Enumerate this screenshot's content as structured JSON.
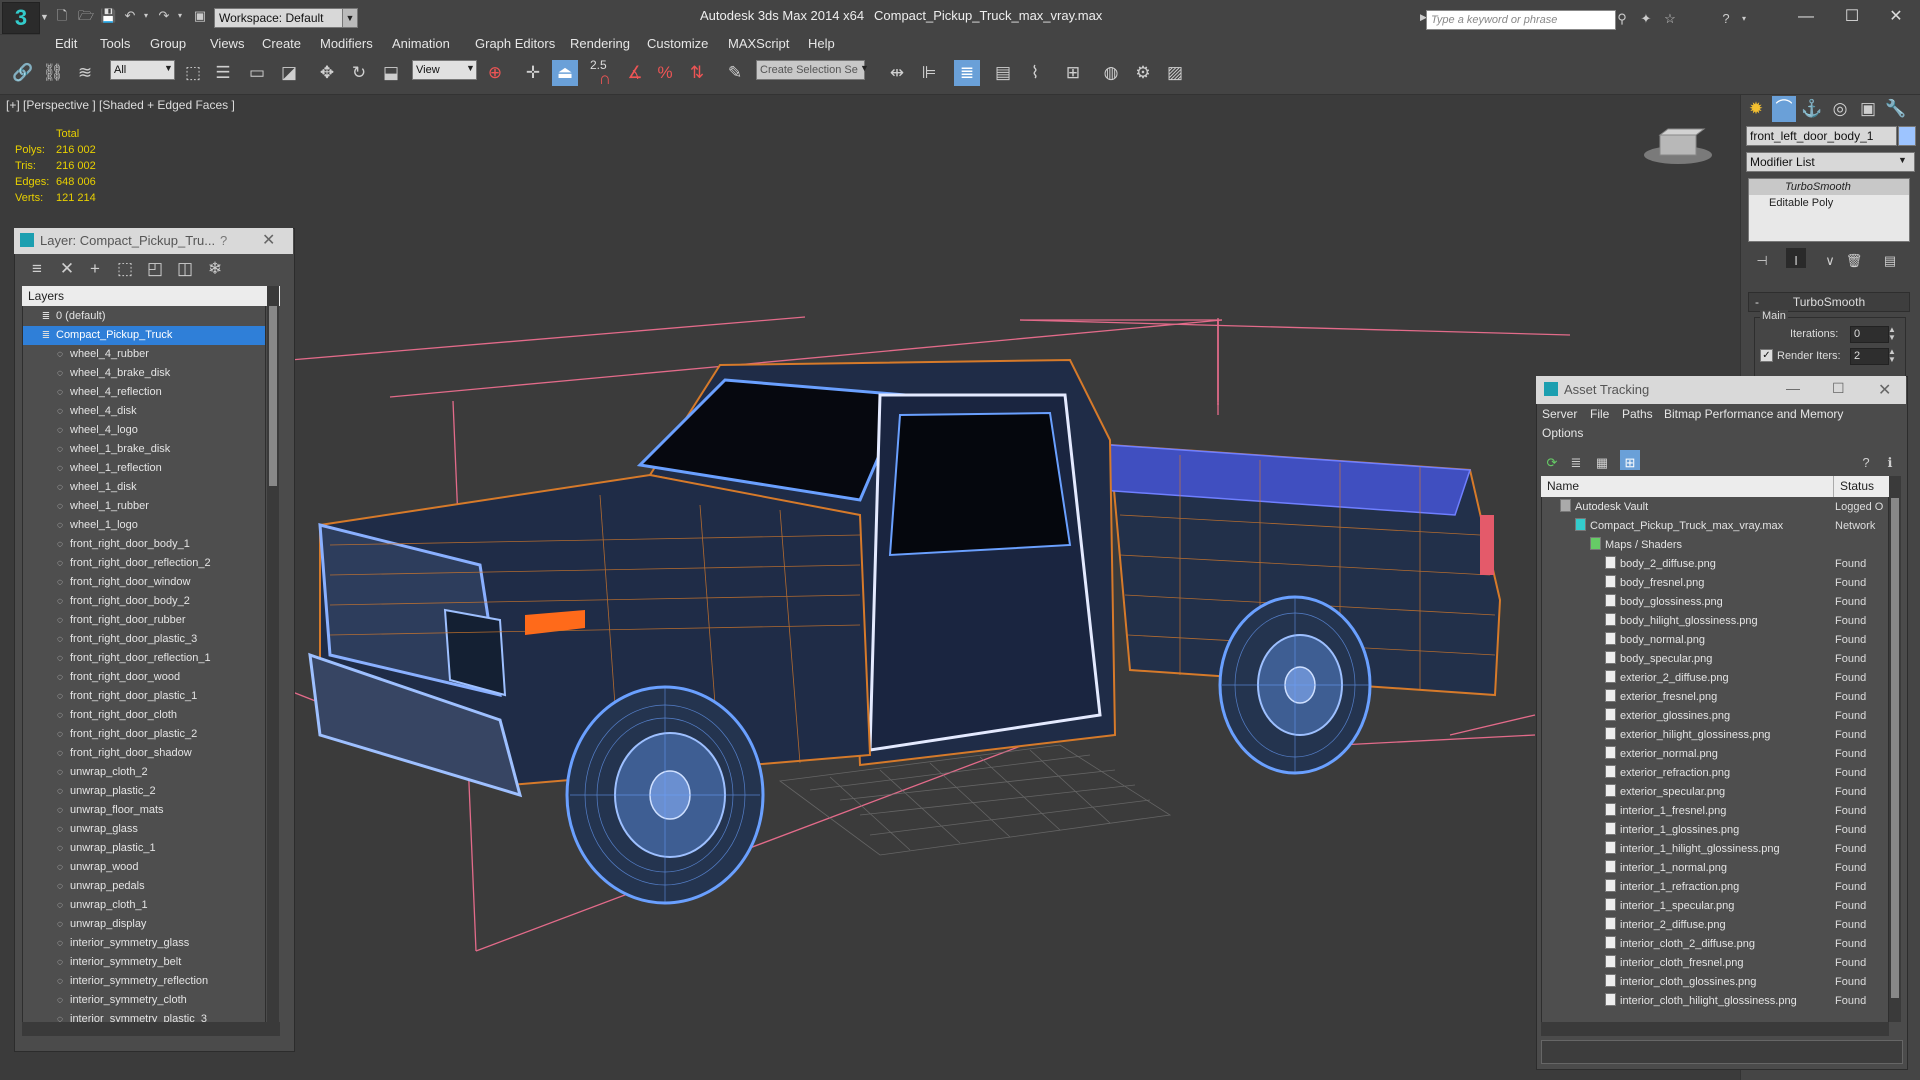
{
  "app": {
    "title": "Autodesk 3ds Max  2014 x64",
    "file": "Compact_Pickup_Truck_max_vray.max",
    "workspace": "Workspace: Default",
    "search_placeholder": "Type a keyword or phrase"
  },
  "menu": [
    "Edit",
    "Tools",
    "Group",
    "Views",
    "Create",
    "Modifiers",
    "Animation",
    "Graph Editors",
    "Rendering",
    "Customize",
    "MAXScript",
    "Help"
  ],
  "toolbar": {
    "selection_filter": "All",
    "ref_coord": "View",
    "snap_value": "2.5",
    "named_selection": "Create Selection Se"
  },
  "viewport": {
    "label": "[+] [Perspective ] [Shaded + Edged Faces ]",
    "stats": {
      "header": "Total",
      "rows": [
        {
          "label": "Polys:",
          "value": "216 002"
        },
        {
          "label": "Tris:",
          "value": "216 002"
        },
        {
          "label": "Edges:",
          "value": "648 006"
        },
        {
          "label": "Verts:",
          "value": "121 214"
        }
      ]
    }
  },
  "layer_window": {
    "title": "Layer: Compact_Pickup_Tru...",
    "help": "?",
    "column": "Layers",
    "rows": [
      {
        "label": "0 (default)",
        "level": 0
      },
      {
        "label": "Compact_Pickup_Truck",
        "level": 0,
        "selected": true
      },
      {
        "label": "wheel_4_rubber",
        "level": 1
      },
      {
        "label": "wheel_4_brake_disk",
        "level": 1
      },
      {
        "label": "wheel_4_reflection",
        "level": 1
      },
      {
        "label": "wheel_4_disk",
        "level": 1
      },
      {
        "label": "wheel_4_logo",
        "level": 1
      },
      {
        "label": "wheel_1_brake_disk",
        "level": 1
      },
      {
        "label": "wheel_1_reflection",
        "level": 1
      },
      {
        "label": "wheel_1_disk",
        "level": 1
      },
      {
        "label": "wheel_1_rubber",
        "level": 1
      },
      {
        "label": "wheel_1_logo",
        "level": 1
      },
      {
        "label": "front_right_door_body_1",
        "level": 1
      },
      {
        "label": "front_right_door_reflection_2",
        "level": 1
      },
      {
        "label": "front_right_door_window",
        "level": 1
      },
      {
        "label": "front_right_door_body_2",
        "level": 1
      },
      {
        "label": "front_right_door_rubber",
        "level": 1
      },
      {
        "label": "front_right_door_plastic_3",
        "level": 1
      },
      {
        "label": "front_right_door_reflection_1",
        "level": 1
      },
      {
        "label": "front_right_door_wood",
        "level": 1
      },
      {
        "label": "front_right_door_plastic_1",
        "level": 1
      },
      {
        "label": "front_right_door_cloth",
        "level": 1
      },
      {
        "label": "front_right_door_plastic_2",
        "level": 1
      },
      {
        "label": "front_right_door_shadow",
        "level": 1
      },
      {
        "label": "unwrap_cloth_2",
        "level": 1
      },
      {
        "label": "unwrap_plastic_2",
        "level": 1
      },
      {
        "label": "unwrap_floor_mats",
        "level": 1
      },
      {
        "label": "unwrap_glass",
        "level": 1
      },
      {
        "label": "unwrap_plastic_1",
        "level": 1
      },
      {
        "label": "unwrap_wood",
        "level": 1
      },
      {
        "label": "unwrap_pedals",
        "level": 1
      },
      {
        "label": "unwrap_cloth_1",
        "level": 1
      },
      {
        "label": "unwrap_display",
        "level": 1
      },
      {
        "label": "interior_symmetry_glass",
        "level": 1
      },
      {
        "label": "interior_symmetry_belt",
        "level": 1
      },
      {
        "label": "interior_symmetry_reflection",
        "level": 1
      },
      {
        "label": "interior_symmetry_cloth",
        "level": 1
      },
      {
        "label": "interior_symmetry_plastic_3",
        "level": 1
      }
    ]
  },
  "command_panel": {
    "object_name": "front_left_door_body_1",
    "modifier_list": "Modifier List",
    "stack": [
      "TurboSmooth",
      "Editable Poly"
    ],
    "rollout_title": "TurboSmooth",
    "group_main": "Main",
    "iterations_label": "Iterations:",
    "iterations_value": "0",
    "render_iters_label": "Render Iters:",
    "render_iters_value": "2"
  },
  "asset_tracking": {
    "title": "Asset Tracking",
    "menu": [
      "Server",
      "File",
      "Paths",
      "Bitmap Performance and Memory"
    ],
    "menu2": "Options",
    "col_name": "Name",
    "col_status": "Status",
    "rows": [
      {
        "name": "Autodesk Vault",
        "status": "Logged O",
        "level": 0
      },
      {
        "name": "Compact_Pickup_Truck_max_vray.max",
        "status": "Network",
        "level": 1
      },
      {
        "name": "Maps / Shaders",
        "status": "",
        "level": 2
      },
      {
        "name": "body_2_diffuse.png",
        "status": "Found",
        "level": 3
      },
      {
        "name": "body_fresnel.png",
        "status": "Found",
        "level": 3
      },
      {
        "name": "body_glossiness.png",
        "status": "Found",
        "level": 3
      },
      {
        "name": "body_hilight_glossiness.png",
        "status": "Found",
        "level": 3
      },
      {
        "name": "body_normal.png",
        "status": "Found",
        "level": 3
      },
      {
        "name": "body_specular.png",
        "status": "Found",
        "level": 3
      },
      {
        "name": "exterior_2_diffuse.png",
        "status": "Found",
        "level": 3
      },
      {
        "name": "exterior_fresnel.png",
        "status": "Found",
        "level": 3
      },
      {
        "name": "exterior_glossines.png",
        "status": "Found",
        "level": 3
      },
      {
        "name": "exterior_hilight_glossiness.png",
        "status": "Found",
        "level": 3
      },
      {
        "name": "exterior_normal.png",
        "status": "Found",
        "level": 3
      },
      {
        "name": "exterior_refraction.png",
        "status": "Found",
        "level": 3
      },
      {
        "name": "exterior_specular.png",
        "status": "Found",
        "level": 3
      },
      {
        "name": "interior_1_fresnel.png",
        "status": "Found",
        "level": 3
      },
      {
        "name": "interior_1_glossines.png",
        "status": "Found",
        "level": 3
      },
      {
        "name": "interior_1_hilight_glossiness.png",
        "status": "Found",
        "level": 3
      },
      {
        "name": "interior_1_normal.png",
        "status": "Found",
        "level": 3
      },
      {
        "name": "interior_1_refraction.png",
        "status": "Found",
        "level": 3
      },
      {
        "name": "interior_1_specular.png",
        "status": "Found",
        "level": 3
      },
      {
        "name": "interior_2_diffuse.png",
        "status": "Found",
        "level": 3
      },
      {
        "name": "interior_cloth_2_diffuse.png",
        "status": "Found",
        "level": 3
      },
      {
        "name": "interior_cloth_fresnel.png",
        "status": "Found",
        "level": 3
      },
      {
        "name": "interior_cloth_glossines.png",
        "status": "Found",
        "level": 3
      },
      {
        "name": "interior_cloth_hilight_glossiness.png",
        "status": "Found",
        "level": 3
      }
    ]
  }
}
